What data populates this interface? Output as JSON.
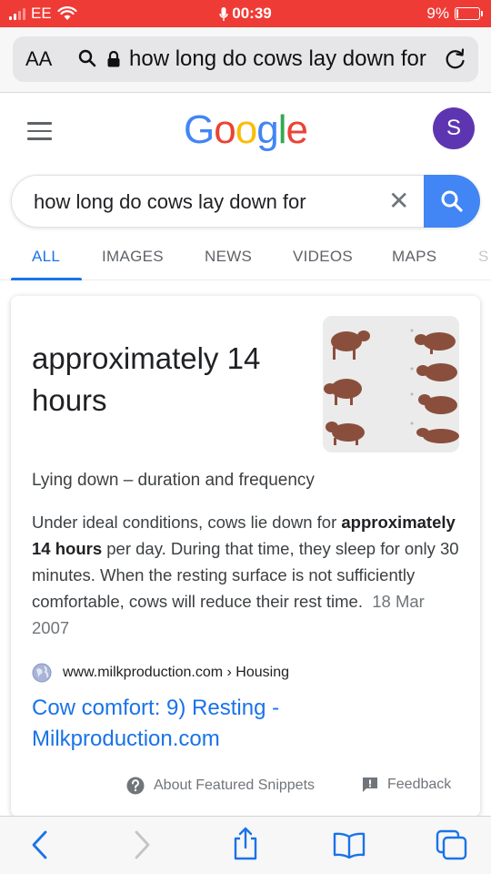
{
  "status_bar": {
    "carrier": "EE",
    "time": "00:39",
    "battery": "9%",
    "battery_level": 0.09
  },
  "address_bar": {
    "aa_label": "AA",
    "url_text": "how long do cows lay down for"
  },
  "header": {
    "logo": [
      "G",
      "o",
      "o",
      "g",
      "l",
      "e"
    ],
    "logo_colors": [
      "#4285F4",
      "#EA4335",
      "#FBBC05",
      "#4285F4",
      "#34A853",
      "#EA4335"
    ],
    "avatar_letter": "S",
    "avatar_color": "#5E35B1"
  },
  "search": {
    "query": "how long do cows lay down for",
    "clear_symbol": "✕"
  },
  "tabs": [
    {
      "label": "ALL",
      "active": true
    },
    {
      "label": "IMAGES",
      "active": false
    },
    {
      "label": "NEWS",
      "active": false
    },
    {
      "label": "VIDEOS",
      "active": false
    },
    {
      "label": "MAPS",
      "active": false
    },
    {
      "label": "S",
      "active": false
    }
  ],
  "featured_snippet": {
    "answer": "approximately 14 hours",
    "subheading": "Lying down – duration and frequency",
    "text_before": "Under ideal conditions, cows lie down for ",
    "text_bold": "approximately 14 hours",
    "text_after": " per day. During that time, they sleep for only 30 minutes. When the resting surface is not sufficiently comfortable, cows will reduce their rest time.",
    "date": "18 Mar 2007",
    "source_domain": "www.milkproduction.com",
    "source_path": "› Housing",
    "result_title": "Cow comfort: 9) Resting - Milkproduction.com",
    "about_label": "About Featured Snippets",
    "feedback_label": "Feedback"
  },
  "colors": {
    "status_bar": "#EF3B36",
    "link_blue": "#1A73E8",
    "search_button": "#4285F4"
  },
  "toolbar_icons": [
    "back-icon",
    "forward-icon",
    "share-icon",
    "bookmarks-icon",
    "tabs-icon"
  ]
}
